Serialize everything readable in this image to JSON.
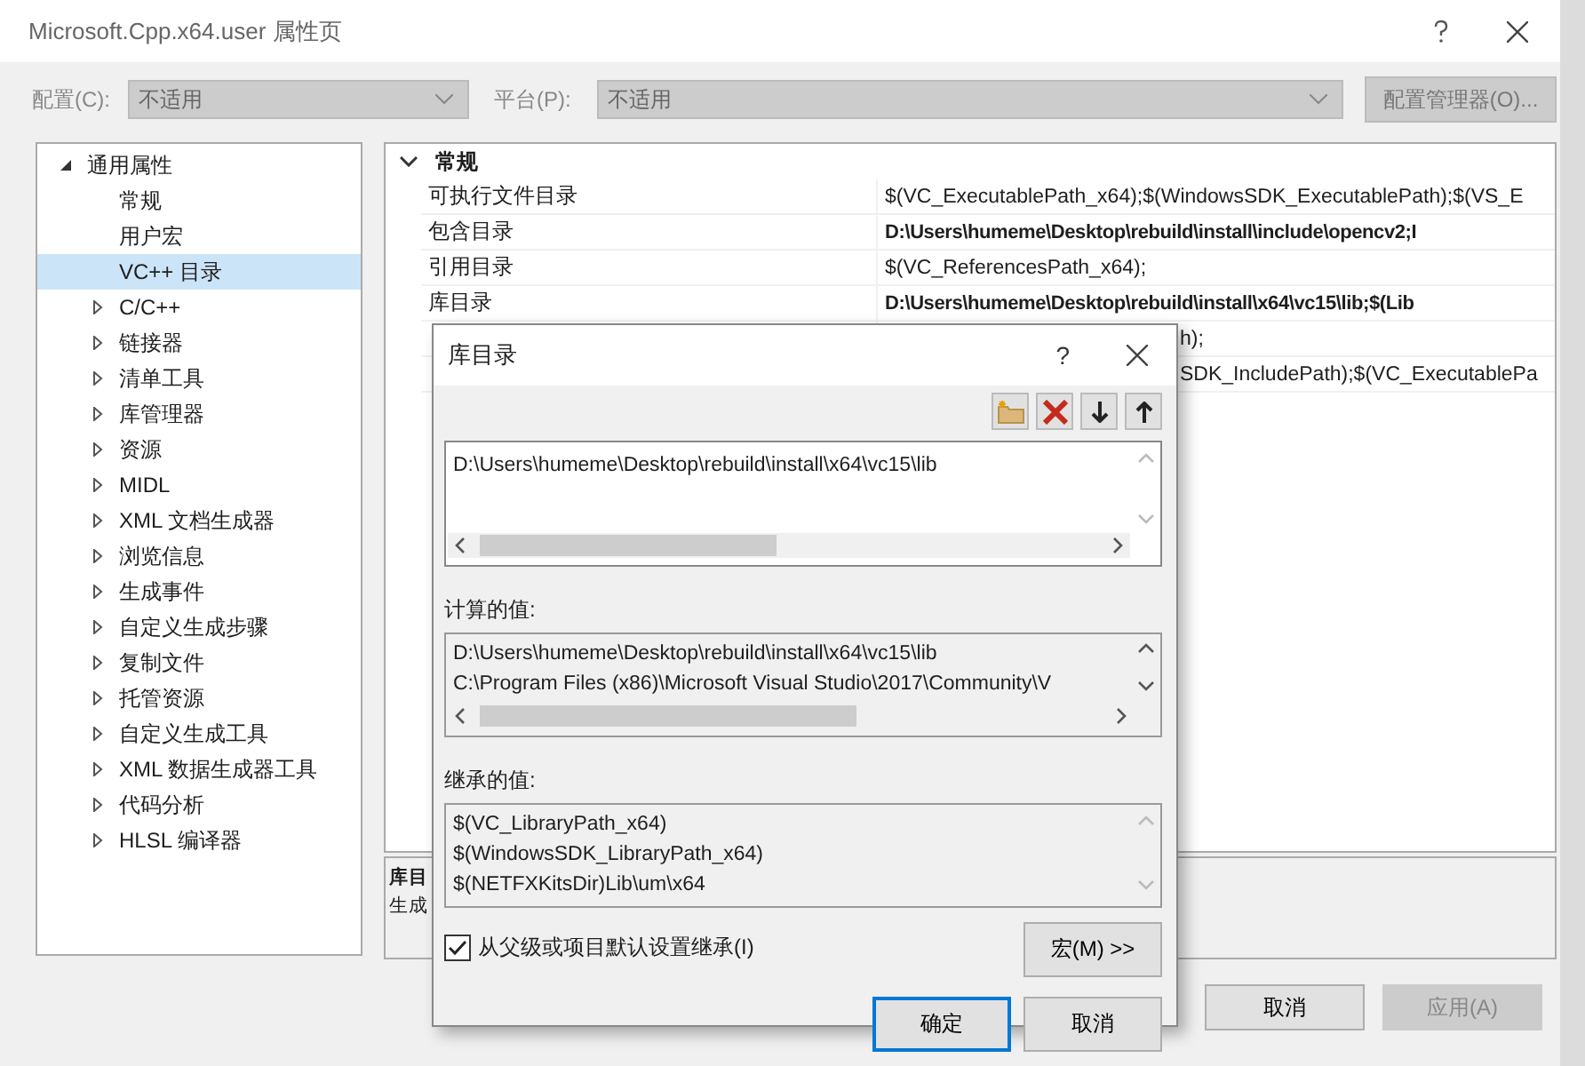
{
  "window": {
    "title": "Microsoft.Cpp.x64.user 属性页"
  },
  "toolbar": {
    "config_label": "配置(C):",
    "config_value": "不适用",
    "platform_label": "平台(P):",
    "platform_value": "不适用",
    "manager_button": {
      "label": "配置管理器(O)...",
      "disabled": true
    }
  },
  "tree": [
    {
      "label": "通用属性",
      "expanded": true,
      "selected": false,
      "children": [
        {
          "label": "常规",
          "selected": false
        },
        {
          "label": "用户宏",
          "selected": false
        },
        {
          "label": "VC++ 目录",
          "selected": true
        },
        {
          "label": "C/C++",
          "selected": false,
          "expanded": false
        },
        {
          "label": "链接器",
          "selected": false,
          "expanded": false
        },
        {
          "label": "清单工具",
          "selected": false,
          "expanded": false
        },
        {
          "label": "库管理器",
          "selected": false,
          "expanded": false
        },
        {
          "label": "资源",
          "selected": false,
          "expanded": false
        },
        {
          "label": "MIDL",
          "selected": false,
          "expanded": false
        },
        {
          "label": "XML 文档生成器",
          "selected": false,
          "expanded": false
        },
        {
          "label": "浏览信息",
          "selected": false,
          "expanded": false
        },
        {
          "label": "生成事件",
          "selected": false,
          "expanded": false
        },
        {
          "label": "自定义生成步骤",
          "selected": false,
          "expanded": false
        },
        {
          "label": "复制文件",
          "selected": false,
          "expanded": false
        },
        {
          "label": "托管资源",
          "selected": false,
          "expanded": false
        },
        {
          "label": "自定义生成工具",
          "selected": false,
          "expanded": false
        },
        {
          "label": "XML 数据生成器工具",
          "selected": false,
          "expanded": false
        },
        {
          "label": "代码分析",
          "selected": false,
          "expanded": false
        },
        {
          "label": "HLSL 编译器",
          "selected": false,
          "expanded": false
        }
      ]
    }
  ],
  "grid": {
    "section": {
      "label": "常规",
      "expanded": true
    },
    "rows": [
      {
        "kind": "full",
        "name": "可执行文件目录",
        "value": "$(VC_ExecutablePath_x64);$(WindowsSDK_ExecutablePath);$(VS_E",
        "bold": false
      },
      {
        "kind": "full",
        "name": "包含目录",
        "value": "D:\\Users\\humeme\\Desktop\\rebuild\\install\\include\\opencv2;I",
        "bold": true
      },
      {
        "kind": "full",
        "name": "引用目录",
        "value": "$(VC_ReferencesPath_x64);",
        "bold": false
      },
      {
        "kind": "full",
        "name": "库目录",
        "value": "D:\\Users\\humeme\\Desktop\\rebuild\\install\\x64\\vc15\\lib;$(Lib",
        "bold": true
      },
      {
        "kind": "covered",
        "value": "h);",
        "bold": false
      },
      {
        "kind": "covered",
        "value": "SDK_IncludePath);$(VC_ExecutablePa",
        "bold": false
      }
    ]
  },
  "description": {
    "title": "库目",
    "text": "生成"
  },
  "buttons": [
    {
      "label": "取消",
      "disabled": false
    },
    {
      "label": "应用(A)",
      "disabled": true
    }
  ],
  "dialog": {
    "title": "库目录",
    "help": "?",
    "edit_lines": [
      "D:\\Users\\humeme\\Desktop\\rebuild\\install\\x64\\vc15\\lib"
    ],
    "computed_label": "计算的值:",
    "computed_lines": [
      "D:\\Users\\humeme\\Desktop\\rebuild\\install\\x64\\vc15\\lib",
      "C:\\Program Files (x86)\\Microsoft Visual Studio\\2017\\Community\\V"
    ],
    "inherited_label": "继承的值:",
    "inherited_lines": [
      "$(VC_LibraryPath_x64)",
      "$(WindowsSDK_LibraryPath_x64)",
      "$(NETFXKitsDir)Lib\\um\\x64"
    ],
    "inherit": {
      "label": "从父级或项目默认设置继承(I)",
      "checked": true
    },
    "macro_button": "宏(M) >>",
    "buttons": [
      {
        "label": "确定",
        "default": true
      },
      {
        "label": "取消",
        "default": false
      }
    ]
  }
}
